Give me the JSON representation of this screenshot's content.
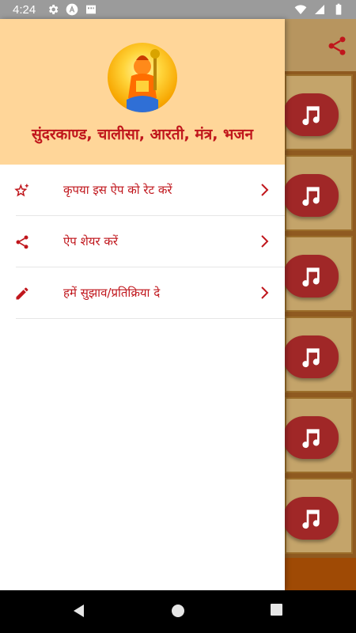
{
  "status_bar": {
    "time": "4:24",
    "left_icons": [
      "gear-icon",
      "a-letter-icon",
      "gallery-icon"
    ],
    "right_icons": [
      "wifi-icon",
      "cellular-signal-icon",
      "battery-icon"
    ]
  },
  "app_background": {
    "share_icon": "share-icon",
    "tile_icon": "music-note-icon",
    "tile_count": 6
  },
  "drawer": {
    "header_image": "hanuman-avatar",
    "title": "सुंदरकाण्ड, चालीसा, आरती, मंत्र, भजन",
    "items": [
      {
        "icon": "star-sparkle-icon",
        "label": "कृपया इस ऐप को रेट करें"
      },
      {
        "icon": "share-icon",
        "label": "ऐप शेयर करें"
      },
      {
        "icon": "pencil-icon",
        "label": "हमें सुझाव/प्रतिक्रिया दे"
      }
    ]
  },
  "navigation_bar": {
    "buttons": [
      "back-icon",
      "home-icon",
      "recents-icon"
    ]
  },
  "colors": {
    "header_bg": "#ffd699",
    "accent_red": "#c0161c",
    "tile_button": "#a02727",
    "app_bg": "#9f4a05"
  }
}
